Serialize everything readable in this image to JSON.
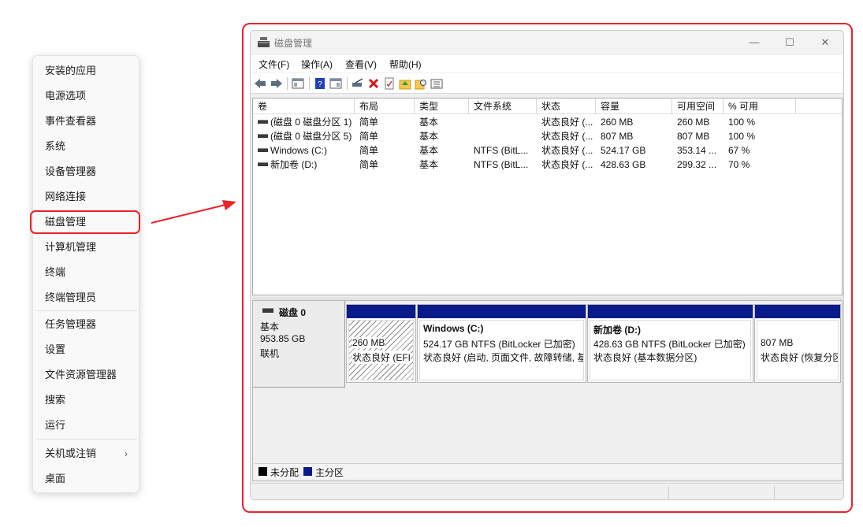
{
  "context_menu": {
    "items": [
      "安装的应用",
      "电源选项",
      "事件查看器",
      "系统",
      "设备管理器",
      "网络连接",
      "磁盘管理",
      "计算机管理",
      "终端",
      "终端管理员",
      "任务管理器",
      "设置",
      "文件资源管理器",
      "搜索",
      "运行",
      "关机或注销",
      "桌面"
    ],
    "submenu_chevron": "›",
    "highlighted_item": "磁盘管理"
  },
  "window": {
    "title": "磁盘管理",
    "controls": {
      "minimize": "—",
      "maximize": "☐",
      "close": "✕"
    },
    "menu": [
      "文件(F)",
      "操作(A)",
      "查看(V)",
      "帮助(H)"
    ],
    "toolbar_icons": [
      "back-arrow-icon",
      "forward-arrow-icon",
      "show-hide-console-tree-icon",
      "help-icon",
      "properties-view-icon",
      "connect-drive-icon",
      "delete-icon",
      "check-properties-icon",
      "folder-up-icon",
      "folder-search-icon",
      "list-icon"
    ]
  },
  "volume_list": {
    "columns": [
      "卷",
      "布局",
      "类型",
      "文件系统",
      "状态",
      "容量",
      "可用空间",
      "% 可用"
    ],
    "rows": [
      [
        "(磁盘 0 磁盘分区 1)",
        "简单",
        "基本",
        "",
        "状态良好 (...",
        "260 MB",
        "260 MB",
        "100 %"
      ],
      [
        "(磁盘 0 磁盘分区 5)",
        "简单",
        "基本",
        "",
        "状态良好 (...",
        "807 MB",
        "807 MB",
        "100 %"
      ],
      [
        "Windows (C:)",
        "简单",
        "基本",
        "NTFS (BitL...",
        "状态良好 (...",
        "524.17 GB",
        "353.14 ...",
        "67 %"
      ],
      [
        "新加卷 (D:)",
        "简单",
        "基本",
        "NTFS (BitL...",
        "状态良好 (...",
        "428.63 GB",
        "299.32 ...",
        "70 %"
      ]
    ]
  },
  "disk0": {
    "name": "磁盘 0",
    "type": "基本",
    "size": "953.85 GB",
    "status": "联机",
    "partitions": [
      {
        "title": "",
        "line1": "260 MB",
        "line2": "状态良好 (EFI"
      },
      {
        "title": "Windows  (C:)",
        "line1": "524.17 GB NTFS (BitLocker 已加密)",
        "line2": "状态良好 (启动, 页面文件, 故障转储, 基"
      },
      {
        "title": "新加卷  (D:)",
        "line1": "428.63 GB NTFS (BitLocker 已加密)",
        "line2": "状态良好 (基本数据分区)"
      },
      {
        "title": "",
        "line1": "807 MB",
        "line2": "状态良好 (恢复分区)"
      }
    ]
  },
  "legend": {
    "unallocated": "未分配",
    "primary": "主分区"
  },
  "colors": {
    "highlight_red": "#e8242a",
    "partition_bar": "#0a1a8a",
    "unallocated": "#000000"
  }
}
